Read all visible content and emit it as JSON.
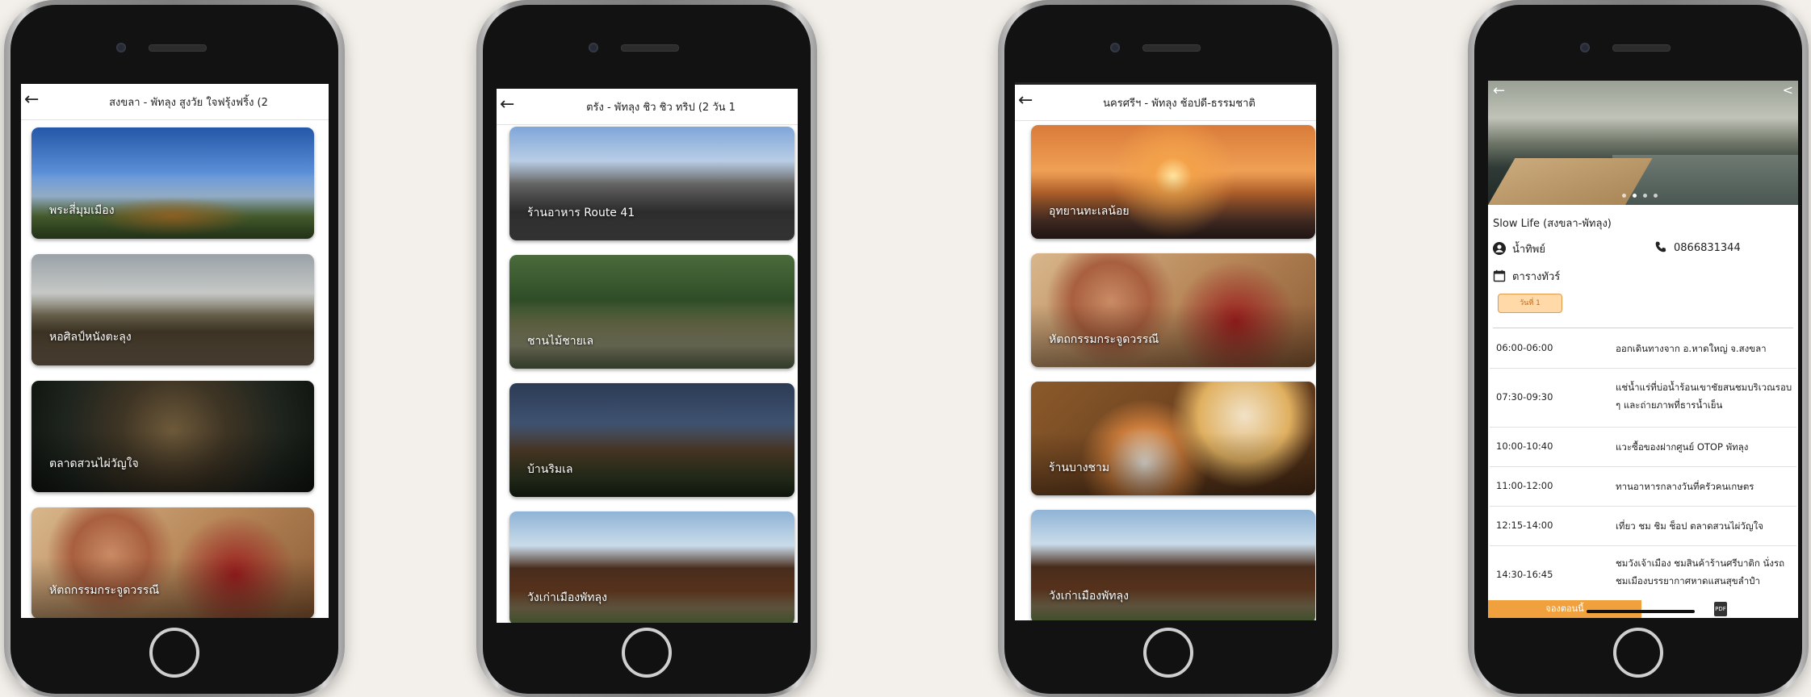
{
  "phones": [
    {
      "title": "สงขลา - พัทลุง สูงวัย ใจฟรุ้งฟริ้ง (2",
      "back_icon": "arrow-left-icon",
      "cards": [
        {
          "label": "พระสี่มุมเมือง"
        },
        {
          "label": "หอศิลป์หนังตะลุง"
        },
        {
          "label": "ตลาดสวนไผ่วัญใจ"
        },
        {
          "label": "หัตถกรรมกระจูดวรรณี"
        }
      ]
    },
    {
      "title": "ตรัง - พัทลุง ชิว ชิว ทริป (2 วัน 1",
      "back_icon": "arrow-left-icon",
      "cards": [
        {
          "label": "ร้านอาหาร Route 41"
        },
        {
          "label": "ชานไม้ชายเล"
        },
        {
          "label": "บ้านริมเล"
        },
        {
          "label": "วังเก่าเมืองพัทลุง"
        }
      ]
    },
    {
      "title": "นครศรีฯ - พัทลุง ช้อปดี-ธรรมชาติ",
      "back_icon": "arrow-left-icon",
      "cards": [
        {
          "label": "อุทยานทะเลน้อย"
        },
        {
          "label": "หัตถกรรมกระจูดวรรณี"
        },
        {
          "label": "ร้านบางชาม"
        },
        {
          "label": "วังเก่าเมืองพัทลุง"
        }
      ]
    }
  ],
  "detail": {
    "title": "Slow Life (สงขลา-พัทลุง)",
    "guide_name": "น้ำทิพย์",
    "phone": "0866831344",
    "schedule_label": "ตารางทัวร์",
    "day_badge": "วันที่ 1",
    "schedule": [
      {
        "time": "06:00-06:00",
        "desc": "ออกเดินทางจาก อ.หาดใหญ่ จ.สงขลา"
      },
      {
        "time": "07:30-09:30",
        "desc": "แช่น้ำแร่ที่บ่อน้ำร้อนเขาชัยสนชมบริเวณรอบ ๆ และถ่ายภาพที่ธารน้ำเย็น"
      },
      {
        "time": "10:00-10:40",
        "desc": "แวะซื้อของฝากศูนย์ OTOP พัทลุง"
      },
      {
        "time": "11:00-12:00",
        "desc": "ทานอาหารกลางวันที่ครัวคนเกษตร"
      },
      {
        "time": "12:15-14:00",
        "desc": "เที่ยว ชม ชิม ช็อป ตลาดสวนไผ่วัญใจ"
      },
      {
        "time": "14:30-16:45",
        "desc": "ชมวังเจ้าเมือง ชมสินค้าร้านศรีบาติก นั่งรถชมเมืองบรรยากาศหาดแสนสุขลำปำ"
      }
    ],
    "book_label": "จองตอนนี้",
    "pdf_label": "PDF"
  }
}
